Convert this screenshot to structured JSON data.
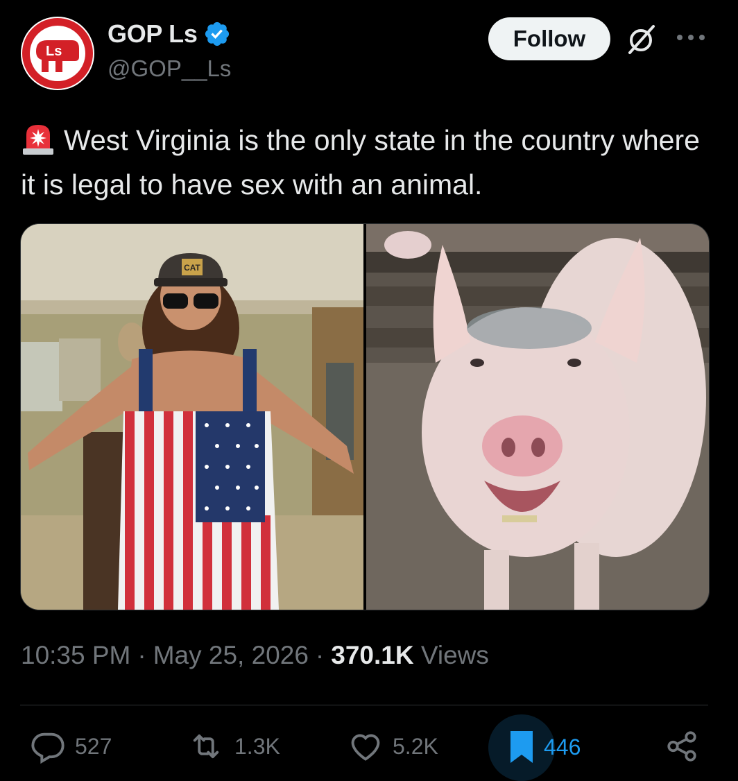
{
  "author": {
    "display_name": "GOP Ls",
    "handle": "@GOP__Ls",
    "avatar_letters": "Ls",
    "verified": true
  },
  "header": {
    "follow_label": "Follow"
  },
  "tweet": {
    "text": "West Virginia is the only state in the country where it is legal to have sex with an animal.",
    "leading_emoji": "siren-icon",
    "hat_text": "CAT"
  },
  "meta": {
    "time": "10:35 PM",
    "separator": "·",
    "date": "May 25, 2026",
    "views_count": "370.1K",
    "views_label": "Views"
  },
  "actions": {
    "replies": "527",
    "reposts": "1.3K",
    "likes": "5.2K",
    "bookmarks": "446"
  },
  "colors": {
    "background": "#000000",
    "text": "#e7e9ea",
    "muted": "#71767b",
    "accent_blue": "#1d9bf0",
    "avatar_red": "#d32027"
  }
}
